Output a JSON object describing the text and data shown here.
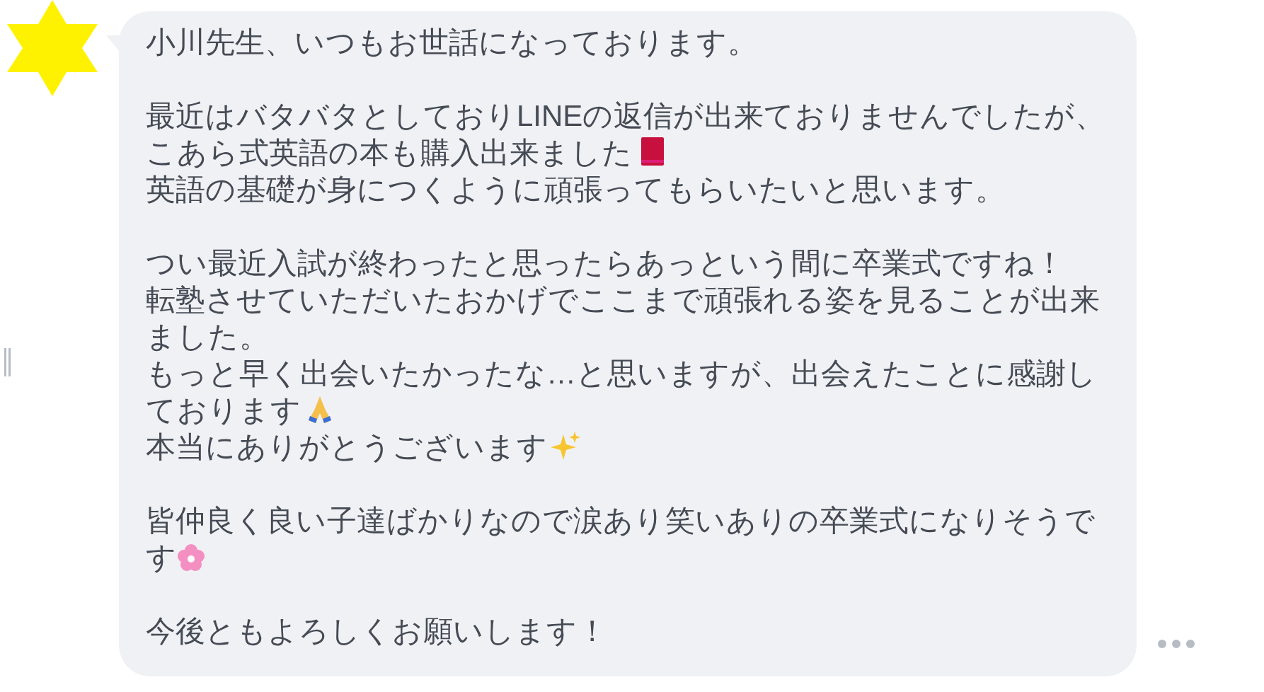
{
  "message": {
    "paragraphs": [
      {
        "lines": [
          {
            "text": "小川先生、いつもお世話になっております。"
          }
        ]
      },
      {
        "lines": [
          {
            "text": "最近はバタバタとしておりLINEの返信が出来ておりませんでしたが、"
          },
          {
            "text": "こあら式英語の本も購入出来ました",
            "emoji": {
              "kind": "book"
            }
          },
          {
            "text": "英語の基礎が身につくように頑張ってもらいたいと思います。"
          }
        ]
      },
      {
        "lines": [
          {
            "text": "つい最近入試が終わったと思ったらあっという間に卒業式ですね！"
          },
          {
            "text": "転塾させていただいたおかげでここまで頑張れる姿を見ることが出来ました。"
          },
          {
            "text": "もっと早く出会いたかったな…と思いますが、出会えたことに感謝しております",
            "emoji": {
              "kind": "pray"
            }
          },
          {
            "text": "本当にありがとうございます",
            "emoji": {
              "kind": "sparkles"
            }
          }
        ]
      },
      {
        "lines": [
          {
            "text": "皆仲良く良い子達ばかりなので涙あり笑いありの卒業式になりそうです",
            "emoji": {
              "kind": "blossom"
            }
          }
        ]
      },
      {
        "lines": [
          {
            "text": "今後ともよろしくお願いします！"
          }
        ]
      }
    ]
  }
}
